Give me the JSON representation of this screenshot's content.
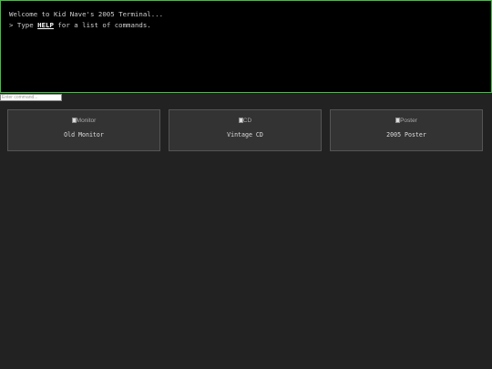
{
  "terminal": {
    "welcome_line": "Welcome to Kid Nave's 2005 Terminal...",
    "hint_prefix": "> Type ",
    "hint_command": "HELP",
    "hint_suffix": " for a list of commands."
  },
  "command_input": {
    "placeholder": "Enter command...",
    "value": ""
  },
  "gallery": {
    "items": [
      {
        "image_alt": "Monitor",
        "label": "Old Monitor"
      },
      {
        "image_alt": "CD",
        "label": "Vintage CD"
      },
      {
        "image_alt": "Poster",
        "label": "2005 Poster"
      }
    ]
  },
  "colors": {
    "page_background": "#222222",
    "terminal_background": "#000000",
    "terminal_border": "#33cc33",
    "card_background": "#333333",
    "card_border": "#555555"
  },
  "icons": {
    "broken_image": "broken-image-icon"
  }
}
